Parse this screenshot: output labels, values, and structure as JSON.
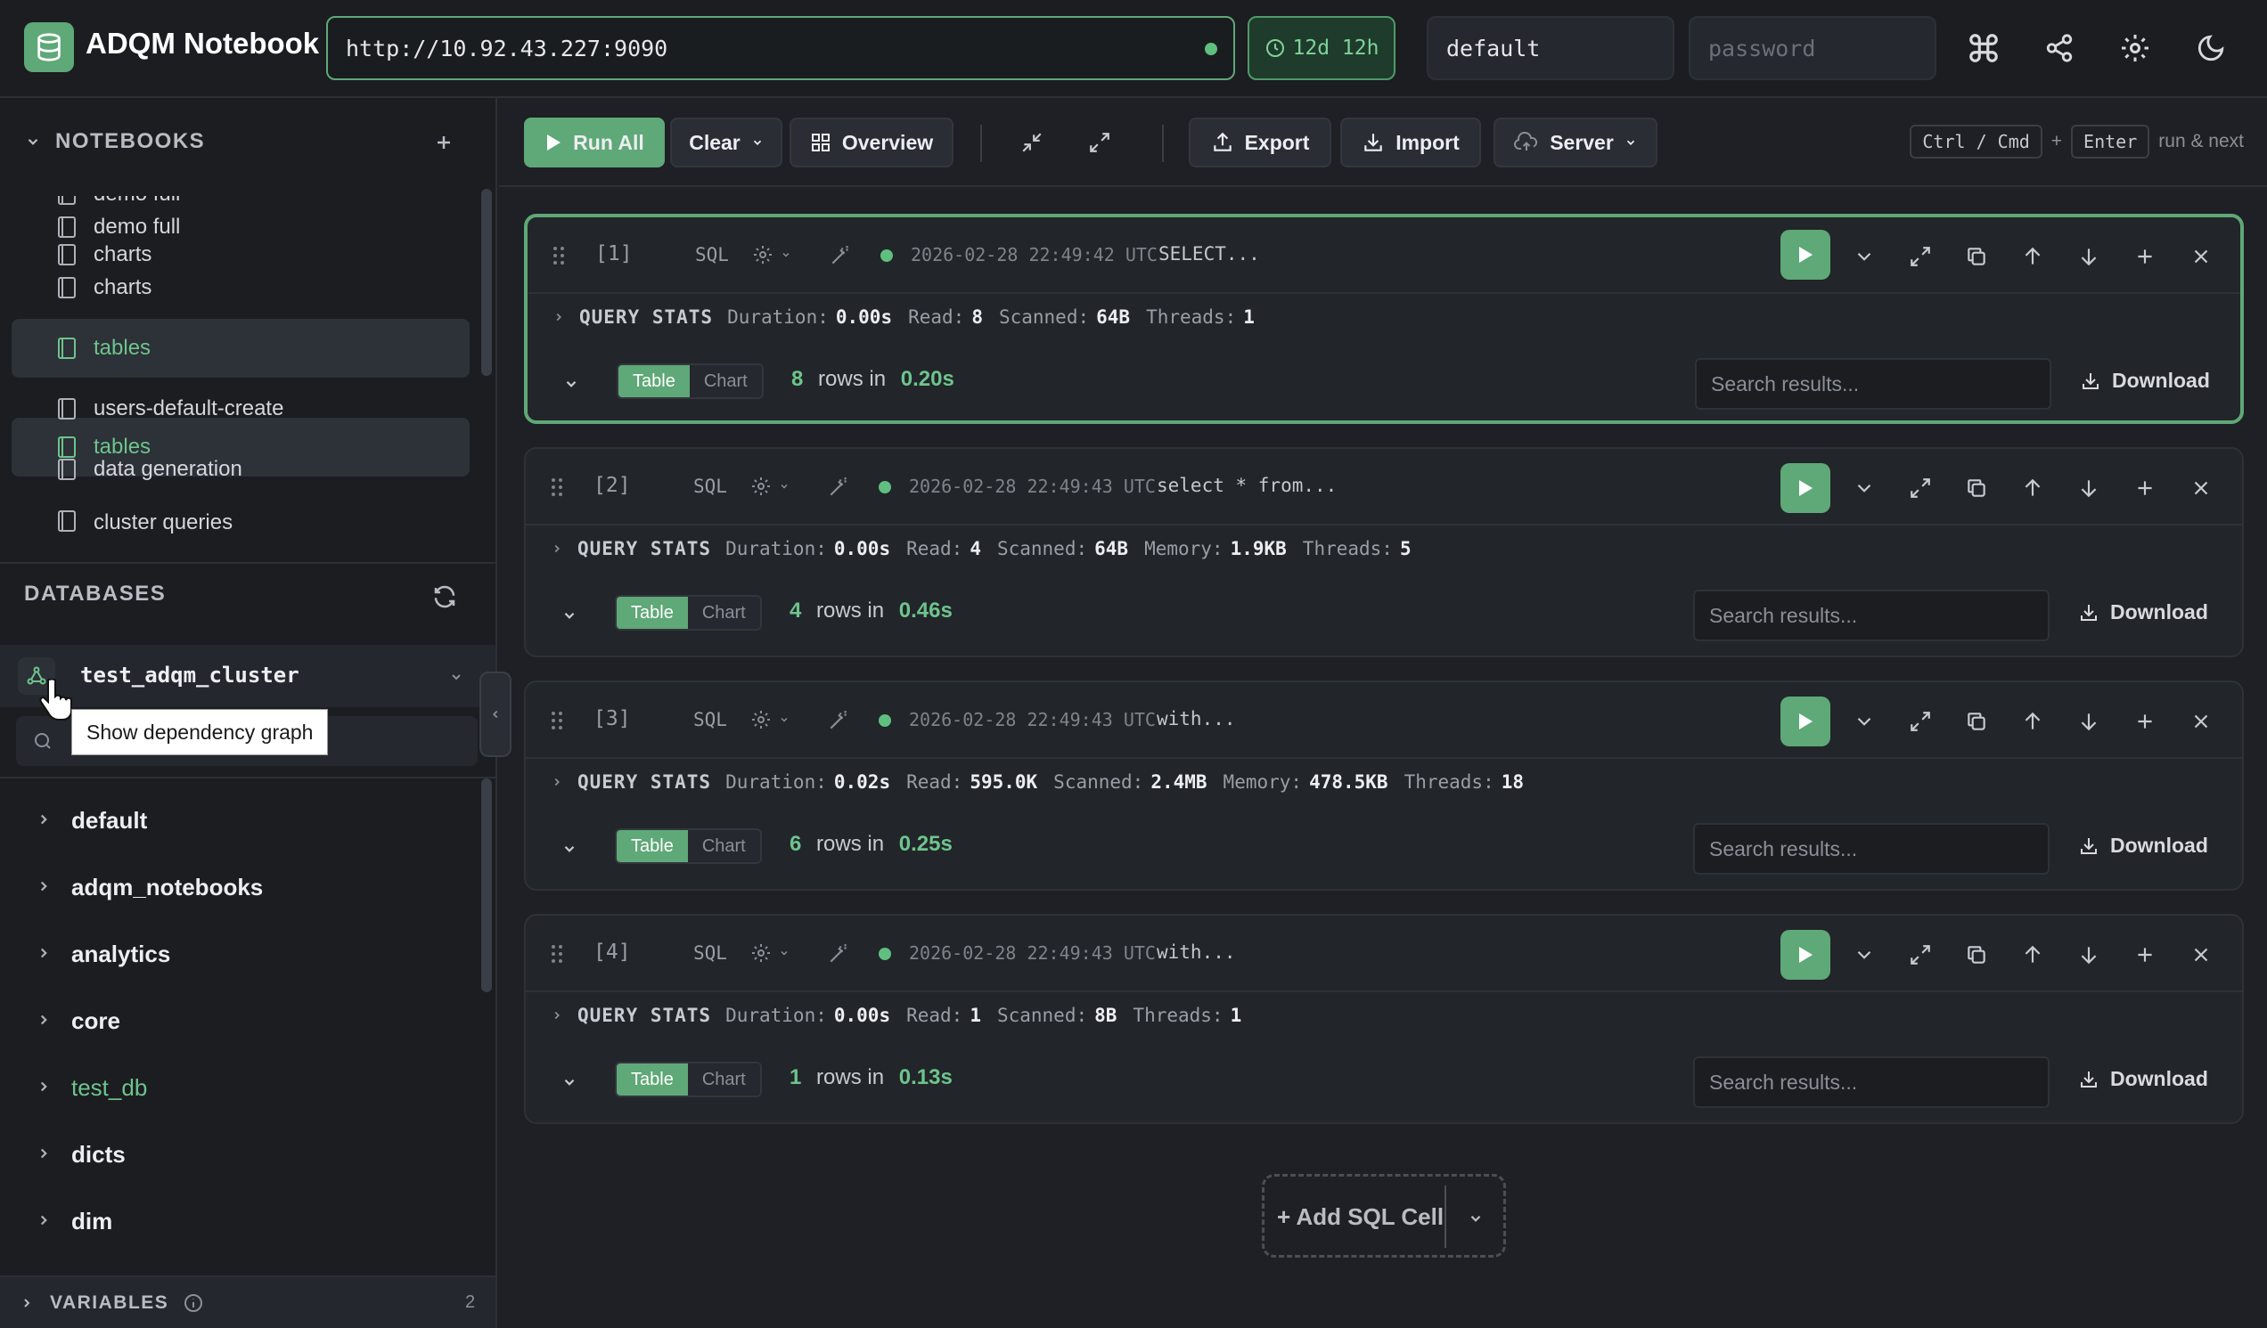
{
  "app": {
    "title": "ADQM Notebook"
  },
  "connection": {
    "url": "http://10.92.43.227:9090",
    "uptime": "12d 12h",
    "user": "default",
    "password_placeholder": "password"
  },
  "sidebar": {
    "notebooks_title": "NOTEBOOKS",
    "notebooks": [
      {
        "label": "demo full"
      },
      {
        "label": "charts"
      },
      {
        "label": "tables",
        "active": true
      },
      {
        "label": "users-default-create"
      },
      {
        "label": "data generation"
      },
      {
        "label": "cluster queries"
      }
    ],
    "databases_title": "DATABASES",
    "cluster": "test_adqm_cluster",
    "tooltip": "Show dependency graph",
    "databases": [
      {
        "label": "default"
      },
      {
        "label": "adqm_notebooks"
      },
      {
        "label": "analytics"
      },
      {
        "label": "core"
      },
      {
        "label": "test_db",
        "highlight": true
      },
      {
        "label": "dicts"
      },
      {
        "label": "dim"
      }
    ],
    "variables_title": "VARIABLES",
    "variables_count": "2"
  },
  "toolbar": {
    "run_all": "Run All",
    "clear": "Clear",
    "overview": "Overview",
    "export": "Export",
    "import": "Import",
    "server": "Server",
    "shortcut_key1": "Ctrl / Cmd",
    "shortcut_plus": "+",
    "shortcut_key2": "Enter",
    "shortcut_hint": "run & next"
  },
  "cells": [
    {
      "index": "[1]",
      "lang": "SQL",
      "timestamp": "2026-02-28 22:49:42 UTC",
      "query": "SELECT...",
      "stats": [
        {
          "label": "Duration:",
          "value": "0.00s"
        },
        {
          "label": "Read:",
          "value": "8"
        },
        {
          "label": "Scanned:",
          "value": "64B"
        },
        {
          "label": "Threads:",
          "value": "1"
        }
      ],
      "rows": "8",
      "time": "0.20s"
    },
    {
      "index": "[2]",
      "lang": "SQL",
      "timestamp": "2026-02-28 22:49:43 UTC",
      "query": "select * from...",
      "stats": [
        {
          "label": "Duration:",
          "value": "0.00s"
        },
        {
          "label": "Read:",
          "value": "4"
        },
        {
          "label": "Scanned:",
          "value": "64B"
        },
        {
          "label": "Memory:",
          "value": "1.9KB"
        },
        {
          "label": "Threads:",
          "value": "5"
        }
      ],
      "rows": "4",
      "time": "0.46s"
    },
    {
      "index": "[3]",
      "lang": "SQL",
      "timestamp": "2026-02-28 22:49:43 UTC",
      "query": "with...",
      "stats": [
        {
          "label": "Duration:",
          "value": "0.02s"
        },
        {
          "label": "Read:",
          "value": "595.0K"
        },
        {
          "label": "Scanned:",
          "value": "2.4MB"
        },
        {
          "label": "Memory:",
          "value": "478.5KB"
        },
        {
          "label": "Threads:",
          "value": "18"
        }
      ],
      "rows": "6",
      "time": "0.25s"
    },
    {
      "index": "[4]",
      "lang": "SQL",
      "timestamp": "2026-02-28 22:49:43 UTC",
      "query": "with...",
      "stats": [
        {
          "label": "Duration:",
          "value": "0.00s"
        },
        {
          "label": "Read:",
          "value": "1"
        },
        {
          "label": "Scanned:",
          "value": "8B"
        },
        {
          "label": "Threads:",
          "value": "1"
        }
      ],
      "rows": "1",
      "time": "0.13s"
    }
  ],
  "cell_common": {
    "stats_title": "QUERY STATS",
    "table_tab": "Table",
    "chart_tab": "Chart",
    "rows_in": "rows in",
    "search_placeholder": "Search results...",
    "download": "Download"
  },
  "add_cell": {
    "label": "+ Add SQL Cell"
  },
  "colors": {
    "accent": "#5fa877",
    "bg": "#1e2025",
    "panel": "#22252a"
  }
}
